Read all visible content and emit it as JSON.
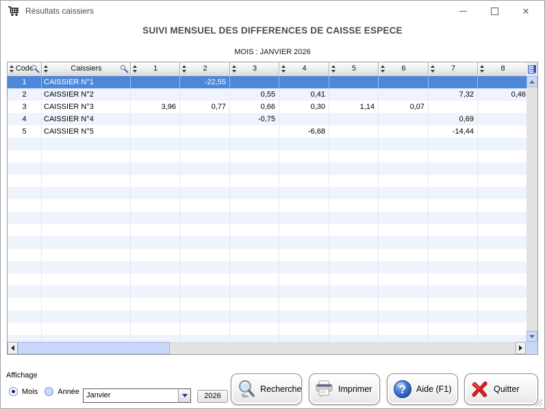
{
  "window": {
    "title": "Résultats caissiers"
  },
  "titlebar": {
    "icons": [
      "shopping-cart-icon",
      "minimize-icon",
      "maximize-icon",
      "close-icon"
    ]
  },
  "header": {
    "title": "SUIVI MENSUEL DES DIFFERENCES DE CAISSE ESPECE",
    "subtitle": "MOIS : JANVIER 2026"
  },
  "table": {
    "columns": [
      {
        "label": "Code",
        "searchable": true
      },
      {
        "label": "Caissiers",
        "searchable": true
      },
      {
        "label": "1"
      },
      {
        "label": "2"
      },
      {
        "label": "3"
      },
      {
        "label": "4"
      },
      {
        "label": "5"
      },
      {
        "label": "6"
      },
      {
        "label": "7"
      },
      {
        "label": "8"
      }
    ],
    "rows": [
      {
        "code": "1",
        "name": "CAISSIER N°1",
        "selected": true,
        "values": [
          "",
          "-22,55",
          "",
          "",
          "",
          "",
          "",
          ""
        ]
      },
      {
        "code": "2",
        "name": "CAISSIER N°2",
        "selected": false,
        "values": [
          "",
          "",
          "0,55",
          "0,41",
          "",
          "",
          "7,32",
          "0,46"
        ]
      },
      {
        "code": "3",
        "name": "CAISSIER N°3",
        "selected": false,
        "values": [
          "3,96",
          "0,77",
          "0,66",
          "0,30",
          "1,14",
          "0,07",
          "",
          ""
        ]
      },
      {
        "code": "4",
        "name": "CAISSIER N°4",
        "selected": false,
        "values": [
          "",
          "",
          "-0,75",
          "",
          "",
          "",
          "0,69",
          ""
        ]
      },
      {
        "code": "5",
        "name": "CAISSIER N°5",
        "selected": false,
        "values": [
          "",
          "",
          "",
          "-6,68",
          "",
          "",
          "-14,44",
          ""
        ]
      }
    ],
    "corner_icon": "table-menu-icon",
    "header_search_icon": "magnifier-icon",
    "sort_icon": "sort-arrows-icon"
  },
  "footer": {
    "affichage_label": "Affichage",
    "radio_mois": "Mois",
    "radio_annee": "Année",
    "radio_selected": "Mois",
    "month_value": "Janvier",
    "year_value": "2026",
    "buttons": [
      {
        "label": "Recherche",
        "icon": "magnifier-icon"
      },
      {
        "label": "Imprimer",
        "icon": "printer-icon"
      },
      {
        "label": "Aide (F1)",
        "icon": "help-icon"
      },
      {
        "label": "Quitter",
        "icon": "quit-x-icon"
      }
    ]
  },
  "colors": {
    "selected_row": "#4e87d8",
    "row_stripe": "#eef3fc",
    "scroll_thumb": "#c9d8fa",
    "help_blue": "#2f62c0",
    "quit_red": "#d81e1e"
  }
}
